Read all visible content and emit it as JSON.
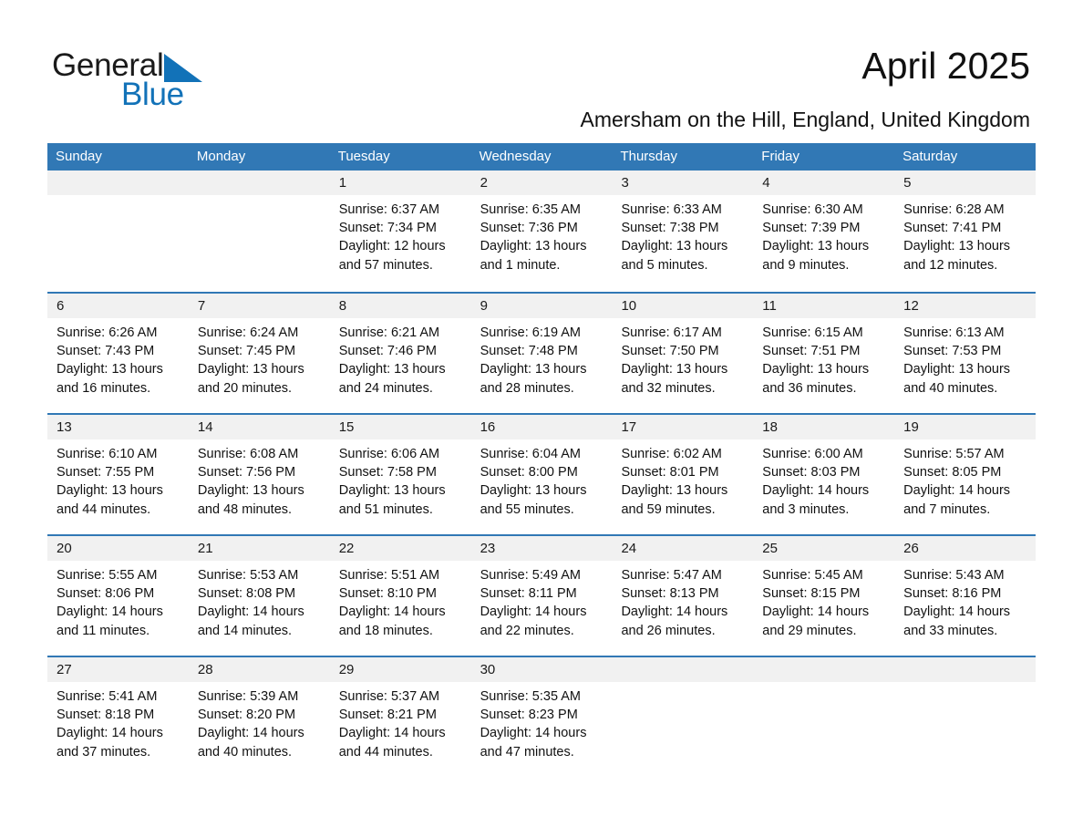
{
  "brand": {
    "logo_text_primary": "General",
    "logo_text_secondary": "Blue",
    "triangle_icon": "triangle-icon",
    "accent_color": "#1272b8"
  },
  "header": {
    "title": "April 2025",
    "subtitle": "Amersham on the Hill, England, United Kingdom"
  },
  "calendar": {
    "header_bg": "#3178b5",
    "row_border_color": "#3178b5",
    "day_band_bg": "#f1f1f1",
    "weekdays": [
      "Sunday",
      "Monday",
      "Tuesday",
      "Wednesday",
      "Thursday",
      "Friday",
      "Saturday"
    ],
    "weeks": [
      [
        {
          "date": "",
          "sunrise": "",
          "sunset": "",
          "daylight_line1": "",
          "daylight_line2": ""
        },
        {
          "date": "",
          "sunrise": "",
          "sunset": "",
          "daylight_line1": "",
          "daylight_line2": ""
        },
        {
          "date": "1",
          "sunrise": "Sunrise: 6:37 AM",
          "sunset": "Sunset: 7:34 PM",
          "daylight_line1": "Daylight: 12 hours",
          "daylight_line2": "and 57 minutes."
        },
        {
          "date": "2",
          "sunrise": "Sunrise: 6:35 AM",
          "sunset": "Sunset: 7:36 PM",
          "daylight_line1": "Daylight: 13 hours",
          "daylight_line2": "and 1 minute."
        },
        {
          "date": "3",
          "sunrise": "Sunrise: 6:33 AM",
          "sunset": "Sunset: 7:38 PM",
          "daylight_line1": "Daylight: 13 hours",
          "daylight_line2": "and 5 minutes."
        },
        {
          "date": "4",
          "sunrise": "Sunrise: 6:30 AM",
          "sunset": "Sunset: 7:39 PM",
          "daylight_line1": "Daylight: 13 hours",
          "daylight_line2": "and 9 minutes."
        },
        {
          "date": "5",
          "sunrise": "Sunrise: 6:28 AM",
          "sunset": "Sunset: 7:41 PM",
          "daylight_line1": "Daylight: 13 hours",
          "daylight_line2": "and 12 minutes."
        }
      ],
      [
        {
          "date": "6",
          "sunrise": "Sunrise: 6:26 AM",
          "sunset": "Sunset: 7:43 PM",
          "daylight_line1": "Daylight: 13 hours",
          "daylight_line2": "and 16 minutes."
        },
        {
          "date": "7",
          "sunrise": "Sunrise: 6:24 AM",
          "sunset": "Sunset: 7:45 PM",
          "daylight_line1": "Daylight: 13 hours",
          "daylight_line2": "and 20 minutes."
        },
        {
          "date": "8",
          "sunrise": "Sunrise: 6:21 AM",
          "sunset": "Sunset: 7:46 PM",
          "daylight_line1": "Daylight: 13 hours",
          "daylight_line2": "and 24 minutes."
        },
        {
          "date": "9",
          "sunrise": "Sunrise: 6:19 AM",
          "sunset": "Sunset: 7:48 PM",
          "daylight_line1": "Daylight: 13 hours",
          "daylight_line2": "and 28 minutes."
        },
        {
          "date": "10",
          "sunrise": "Sunrise: 6:17 AM",
          "sunset": "Sunset: 7:50 PM",
          "daylight_line1": "Daylight: 13 hours",
          "daylight_line2": "and 32 minutes."
        },
        {
          "date": "11",
          "sunrise": "Sunrise: 6:15 AM",
          "sunset": "Sunset: 7:51 PM",
          "daylight_line1": "Daylight: 13 hours",
          "daylight_line2": "and 36 minutes."
        },
        {
          "date": "12",
          "sunrise": "Sunrise: 6:13 AM",
          "sunset": "Sunset: 7:53 PM",
          "daylight_line1": "Daylight: 13 hours",
          "daylight_line2": "and 40 minutes."
        }
      ],
      [
        {
          "date": "13",
          "sunrise": "Sunrise: 6:10 AM",
          "sunset": "Sunset: 7:55 PM",
          "daylight_line1": "Daylight: 13 hours",
          "daylight_line2": "and 44 minutes."
        },
        {
          "date": "14",
          "sunrise": "Sunrise: 6:08 AM",
          "sunset": "Sunset: 7:56 PM",
          "daylight_line1": "Daylight: 13 hours",
          "daylight_line2": "and 48 minutes."
        },
        {
          "date": "15",
          "sunrise": "Sunrise: 6:06 AM",
          "sunset": "Sunset: 7:58 PM",
          "daylight_line1": "Daylight: 13 hours",
          "daylight_line2": "and 51 minutes."
        },
        {
          "date": "16",
          "sunrise": "Sunrise: 6:04 AM",
          "sunset": "Sunset: 8:00 PM",
          "daylight_line1": "Daylight: 13 hours",
          "daylight_line2": "and 55 minutes."
        },
        {
          "date": "17",
          "sunrise": "Sunrise: 6:02 AM",
          "sunset": "Sunset: 8:01 PM",
          "daylight_line1": "Daylight: 13 hours",
          "daylight_line2": "and 59 minutes."
        },
        {
          "date": "18",
          "sunrise": "Sunrise: 6:00 AM",
          "sunset": "Sunset: 8:03 PM",
          "daylight_line1": "Daylight: 14 hours",
          "daylight_line2": "and 3 minutes."
        },
        {
          "date": "19",
          "sunrise": "Sunrise: 5:57 AM",
          "sunset": "Sunset: 8:05 PM",
          "daylight_line1": "Daylight: 14 hours",
          "daylight_line2": "and 7 minutes."
        }
      ],
      [
        {
          "date": "20",
          "sunrise": "Sunrise: 5:55 AM",
          "sunset": "Sunset: 8:06 PM",
          "daylight_line1": "Daylight: 14 hours",
          "daylight_line2": "and 11 minutes."
        },
        {
          "date": "21",
          "sunrise": "Sunrise: 5:53 AM",
          "sunset": "Sunset: 8:08 PM",
          "daylight_line1": "Daylight: 14 hours",
          "daylight_line2": "and 14 minutes."
        },
        {
          "date": "22",
          "sunrise": "Sunrise: 5:51 AM",
          "sunset": "Sunset: 8:10 PM",
          "daylight_line1": "Daylight: 14 hours",
          "daylight_line2": "and 18 minutes."
        },
        {
          "date": "23",
          "sunrise": "Sunrise: 5:49 AM",
          "sunset": "Sunset: 8:11 PM",
          "daylight_line1": "Daylight: 14 hours",
          "daylight_line2": "and 22 minutes."
        },
        {
          "date": "24",
          "sunrise": "Sunrise: 5:47 AM",
          "sunset": "Sunset: 8:13 PM",
          "daylight_line1": "Daylight: 14 hours",
          "daylight_line2": "and 26 minutes."
        },
        {
          "date": "25",
          "sunrise": "Sunrise: 5:45 AM",
          "sunset": "Sunset: 8:15 PM",
          "daylight_line1": "Daylight: 14 hours",
          "daylight_line2": "and 29 minutes."
        },
        {
          "date": "26",
          "sunrise": "Sunrise: 5:43 AM",
          "sunset": "Sunset: 8:16 PM",
          "daylight_line1": "Daylight: 14 hours",
          "daylight_line2": "and 33 minutes."
        }
      ],
      [
        {
          "date": "27",
          "sunrise": "Sunrise: 5:41 AM",
          "sunset": "Sunset: 8:18 PM",
          "daylight_line1": "Daylight: 14 hours",
          "daylight_line2": "and 37 minutes."
        },
        {
          "date": "28",
          "sunrise": "Sunrise: 5:39 AM",
          "sunset": "Sunset: 8:20 PM",
          "daylight_line1": "Daylight: 14 hours",
          "daylight_line2": "and 40 minutes."
        },
        {
          "date": "29",
          "sunrise": "Sunrise: 5:37 AM",
          "sunset": "Sunset: 8:21 PM",
          "daylight_line1": "Daylight: 14 hours",
          "daylight_line2": "and 44 minutes."
        },
        {
          "date": "30",
          "sunrise": "Sunrise: 5:35 AM",
          "sunset": "Sunset: 8:23 PM",
          "daylight_line1": "Daylight: 14 hours",
          "daylight_line2": "and 47 minutes."
        },
        {
          "date": "",
          "sunrise": "",
          "sunset": "",
          "daylight_line1": "",
          "daylight_line2": ""
        },
        {
          "date": "",
          "sunrise": "",
          "sunset": "",
          "daylight_line1": "",
          "daylight_line2": ""
        },
        {
          "date": "",
          "sunrise": "",
          "sunset": "",
          "daylight_line1": "",
          "daylight_line2": ""
        }
      ]
    ]
  }
}
